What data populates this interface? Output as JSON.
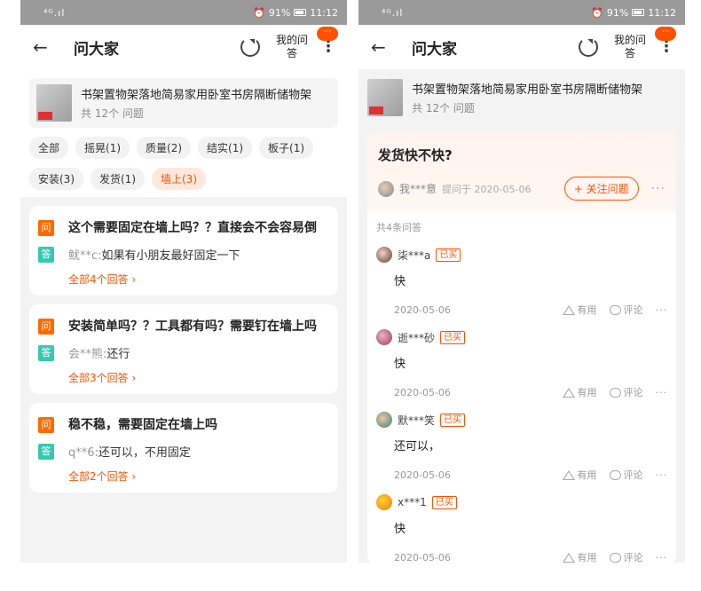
{
  "status": {
    "signal": "⁴ᴳ.ıl",
    "battery": "91%",
    "time": "11:12"
  },
  "left": {
    "title": "问大家",
    "my_qa": "我的问答",
    "badge": "···",
    "product": {
      "name": "书架置物架落地简易家用卧室书房隔断储物架",
      "count": "共 12个 问题"
    },
    "tags": [
      "全部",
      "摇晃(1)",
      "质量(2)",
      "结实(1)",
      "板子(1)",
      "安装(3)",
      "发货(1)",
      "墙上(3)"
    ],
    "questions": [
      {
        "q": "这个需要固定在墙上吗？？直接会不会容易倒",
        "user": "鱿**c:",
        "answer": "如果有小朋友最好固定一下",
        "more": "全部4个回答 ›"
      },
      {
        "q": "安装简单吗？？工具都有吗？需要钉在墙上吗",
        "user": "会**熊:",
        "answer": "还行",
        "more": "全部3个回答 ›"
      },
      {
        "q": "稳不稳，需要固定在墙上吗",
        "user": "q**6:",
        "answer": "还可以，不用固定",
        "more": "全部2个回答 ›"
      }
    ],
    "q_label": "问",
    "a_label": "答"
  },
  "right": {
    "title": "问大家",
    "my_qa": "我的问答",
    "badge": "···",
    "product": {
      "name": "书架置物架落地简易家用卧室书房隔断储物架",
      "count": "共 12个 问题"
    },
    "question": "发货快不快?",
    "asker": "我***意",
    "ask_date": "提问于 2020-05-06",
    "follow": "+ 关注问题",
    "answer_count": "共4条问答",
    "bought": "已买",
    "useful": "有用",
    "comment": "评论",
    "answers": [
      {
        "name": "柒***a",
        "text": "快",
        "date": "2020-05-06"
      },
      {
        "name": "逝***砂",
        "text": "快",
        "date": "2020-05-06"
      },
      {
        "name": "默***笑",
        "text": "还可以，",
        "date": "2020-05-06"
      },
      {
        "name": "x***1",
        "text": "快",
        "date": "2020-05-06"
      }
    ]
  }
}
